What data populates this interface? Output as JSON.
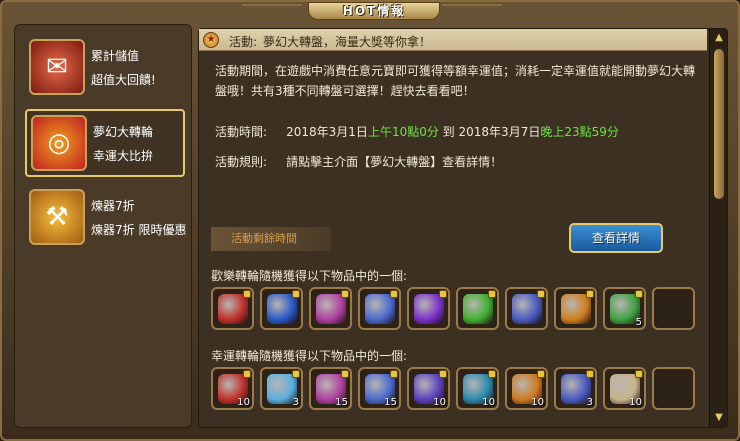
{
  "title": "HOT情報",
  "sidebar": {
    "items": [
      {
        "label": "累計儲值",
        "sub": "超值大回饋!",
        "icon": "red-envelope-icon",
        "selected": false
      },
      {
        "label": "夢幻大轉輪",
        "sub": "幸運大比拚",
        "icon": "spin-wheel-icon",
        "selected": true
      },
      {
        "label": "煉器7折",
        "sub": "煉器7折 限時優惠",
        "icon": "forge-hammer-icon",
        "selected": false
      }
    ]
  },
  "header": {
    "label": "活動:",
    "text": "夢幻大轉盤，海量大獎等你拿！"
  },
  "description": "活動期間，在遊戲中消費任意元寶即可獲得等額幸運值；消耗一定幸運值就能開動夢幻大轉盤哦！共有3種不同轉盤可選擇！趕快去看看吧！",
  "time": {
    "label": "活動時間:",
    "start_date": "2018年3月1日",
    "start_time": "上午10點0分",
    "to": "到",
    "end_date": "2018年3月7日",
    "end_time": "晚上23點59分"
  },
  "rules": {
    "label": "活動規則:",
    "text": "請點擊主介面【夢幻大轉盤】查看詳情！"
  },
  "duration_label": "活動剩餘時間",
  "view_button": "查看詳情",
  "grid1": {
    "title": "歡樂轉輪隨機獲得以下物品中的一個:",
    "items": [
      {
        "icon": "red-orb-icon",
        "color": "#c0302a",
        "count": ""
      },
      {
        "icon": "blue-crystal-icon",
        "color": "#2a5ac8",
        "count": ""
      },
      {
        "icon": "pink-gem-icon",
        "color": "#b040a0",
        "count": ""
      },
      {
        "icon": "staff-icon",
        "color": "#4a6ad0",
        "count": ""
      },
      {
        "icon": "purple-gem-icon",
        "color": "#7a30c8",
        "count": ""
      },
      {
        "icon": "green-orb-icon",
        "color": "#40b030",
        "count": ""
      },
      {
        "icon": "blue-tag-icon",
        "color": "#4a5ac0",
        "count": ""
      },
      {
        "icon": "bell-icon",
        "color": "#d08020",
        "count": ""
      },
      {
        "icon": "gift-icon",
        "color": "#40a040",
        "count": "5"
      },
      {
        "icon": "empty-slot-icon",
        "color": "",
        "count": ""
      }
    ]
  },
  "grid2": {
    "title": "幸運轉輪隨機獲得以下物品中的一個:",
    "items": [
      {
        "icon": "red-orb-icon",
        "color": "#c0302a",
        "count": "10"
      },
      {
        "icon": "blue-crystal-icon",
        "color": "#5ab0e0",
        "count": "3"
      },
      {
        "icon": "pink-gem-icon",
        "color": "#b040a0",
        "count": "15"
      },
      {
        "icon": "staff-icon",
        "color": "#4a6ad0",
        "count": "15"
      },
      {
        "icon": "purple-orb-icon",
        "color": "#5a40c0",
        "count": "10"
      },
      {
        "icon": "teal-orb-icon",
        "color": "#2a8ab0",
        "count": "10"
      },
      {
        "icon": "orange-tag-icon",
        "color": "#d07a20",
        "count": "10"
      },
      {
        "icon": "blue-tag-icon",
        "color": "#4a5ac0",
        "count": "3"
      },
      {
        "icon": "scroll-icon",
        "color": "#c8b48a",
        "count": "10"
      },
      {
        "icon": "empty-slot-icon",
        "color": "",
        "count": ""
      }
    ]
  }
}
